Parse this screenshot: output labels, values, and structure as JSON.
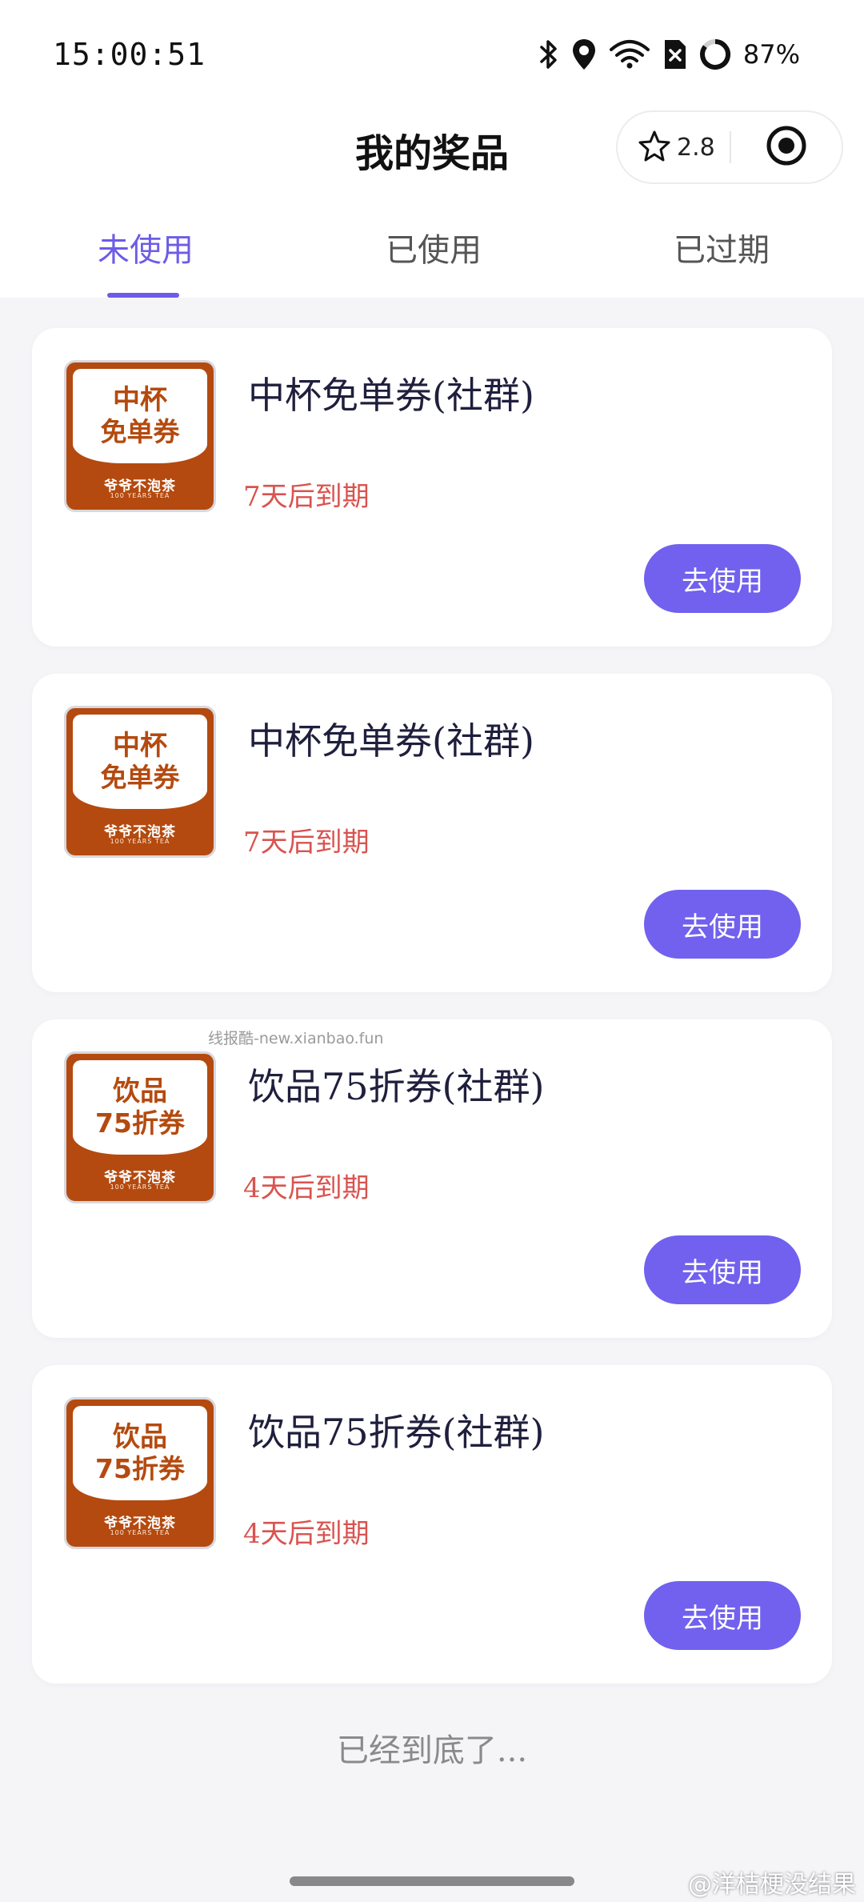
{
  "status_bar": {
    "time": "15:00:51",
    "battery": "87%",
    "icons": [
      "bluetooth-icon",
      "location-icon",
      "wifi-icon",
      "sim-error-icon",
      "battery-ring-icon"
    ]
  },
  "header": {
    "title": "我的奖品",
    "capsule": {
      "score": "2.8",
      "left_icon": "star-outline-icon",
      "right_icon": "target-icon"
    }
  },
  "tabs": [
    {
      "label": "未使用",
      "active": true
    },
    {
      "label": "已使用",
      "active": false
    },
    {
      "label": "已过期",
      "active": false
    }
  ],
  "cards": [
    {
      "image_line1": "中杯",
      "image_line2": "免单券",
      "image_brand": "爷爷不泡茶",
      "image_brand_sub": "100 YEARS TEA",
      "title": "中杯免单券(社群)",
      "expiry": "7天后到期",
      "button": "去使用"
    },
    {
      "image_line1": "中杯",
      "image_line2": "免单券",
      "image_brand": "爷爷不泡茶",
      "image_brand_sub": "100 YEARS TEA",
      "title": "中杯免单券(社群)",
      "expiry": "7天后到期",
      "button": "去使用"
    },
    {
      "image_line1": "饮品",
      "image_line2": "75折券",
      "image_brand": "爷爷不泡茶",
      "image_brand_sub": "100 YEARS TEA",
      "title": "饮品75折券(社群)",
      "expiry": "4天后到期",
      "button": "去使用"
    },
    {
      "image_line1": "饮品",
      "image_line2": "75折券",
      "image_brand": "爷爷不泡茶",
      "image_brand_sub": "100 YEARS TEA",
      "title": "饮品75折券(社群)",
      "expiry": "4天后到期",
      "button": "去使用"
    }
  ],
  "watermark_mid": "线报酷-new.xianbao.fun",
  "end_text": "已经到底了...",
  "watermark_bottom": "@洋桔梗没结果",
  "colors": {
    "accent": "#6c5ce7",
    "button": "#7161ee",
    "expiry": "#d9534f",
    "coupon_brown": "#b44a0f"
  }
}
